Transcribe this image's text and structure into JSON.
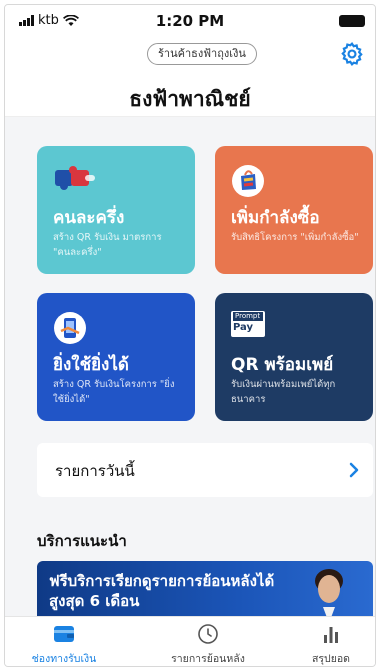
{
  "status_bar": {
    "carrier": "ktb",
    "time": "1:20 PM"
  },
  "header": {
    "shop_button": "ร้านค้าธงฟ้าถุงเงิน",
    "shop_name": "ธงฟ้าพาณิชย์",
    "settings_icon": "gear-icon"
  },
  "cards": [
    {
      "title": "คนละครึ่ง",
      "subtitle": "สร้าง QR รับเงิน มาตรการ \"คนละครึ่ง\"",
      "color": "#5cc7d1"
    },
    {
      "title": "เพิ่มกำลังซื้อ",
      "subtitle": "รับสิทธิโครงการ \"เพิ่มกำลังซื้อ\"",
      "color": "#e8764e"
    },
    {
      "title": "ยิ่งใช้ยิ่งได้",
      "subtitle": "สร้าง QR รับเงินโครงการ \"ยิ่งใช้ยิ่งได้\"",
      "color": "#2155c7"
    },
    {
      "title": "QR พร้อมเพย์",
      "subtitle": "รับเงินผ่านพร้อมเพย์ได้ทุกธนาคาร",
      "color": "#1e3b64",
      "logo_line1": "Prompt",
      "logo_line2": "Pay"
    }
  ],
  "today": {
    "label": "รายการวันนี้"
  },
  "recommended": {
    "title": "บริการแนะนำ",
    "banner_text": "ฟรีบริการเรียกดูรายการย้อนหลังได้สูงสุด 6 เดือน"
  },
  "tabbar": {
    "items": [
      {
        "label": "ช่องทางรับเงิน",
        "icon": "wallet-icon",
        "active": true
      },
      {
        "label": "รายการย้อนหลัง",
        "icon": "clock-icon",
        "active": false
      },
      {
        "label": "สรุปยอด",
        "icon": "bar-chart-icon",
        "active": false
      }
    ]
  },
  "colors": {
    "accent": "#1a82e2"
  }
}
